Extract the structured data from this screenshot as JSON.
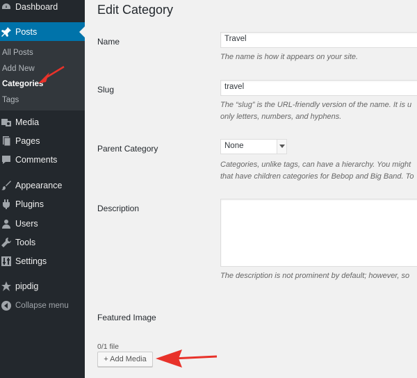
{
  "sidebar": {
    "dashboard": "Dashboard",
    "posts": "Posts",
    "submenu": {
      "all_posts": "All Posts",
      "add_new": "Add New",
      "categories": "Categories",
      "tags": "Tags"
    },
    "media": "Media",
    "pages": "Pages",
    "comments": "Comments",
    "appearance": "Appearance",
    "plugins": "Plugins",
    "users": "Users",
    "tools": "Tools",
    "settings": "Settings",
    "pipdig": "pipdig",
    "collapse": "Collapse menu"
  },
  "page": {
    "title": "Edit Category"
  },
  "form": {
    "name_label": "Name",
    "name_value": "Travel",
    "name_desc": "The name is how it appears on your site.",
    "slug_label": "Slug",
    "slug_value": "travel",
    "slug_desc_1": "The “slug” is the URL-friendly version of the name. It is u",
    "slug_desc_2": "only letters, numbers, and hyphens.",
    "parent_label": "Parent Category",
    "parent_value": "None",
    "parent_desc_1": "Categories, unlike tags, can have a hierarchy. You might",
    "parent_desc_2": "that have children categories for Bebop and Big Band. To",
    "description_label": "Description",
    "description_value": "",
    "description_desc": "The description is not prominent by default; however, so",
    "featured_label": "Featured Image",
    "file_count": "0/1 file",
    "add_media": "+ Add Media"
  },
  "colors": {
    "sidebar_bg": "#23282d",
    "submenu_bg": "#32373c",
    "active": "#0073aa",
    "annotation_arrow": "#e8322a"
  }
}
